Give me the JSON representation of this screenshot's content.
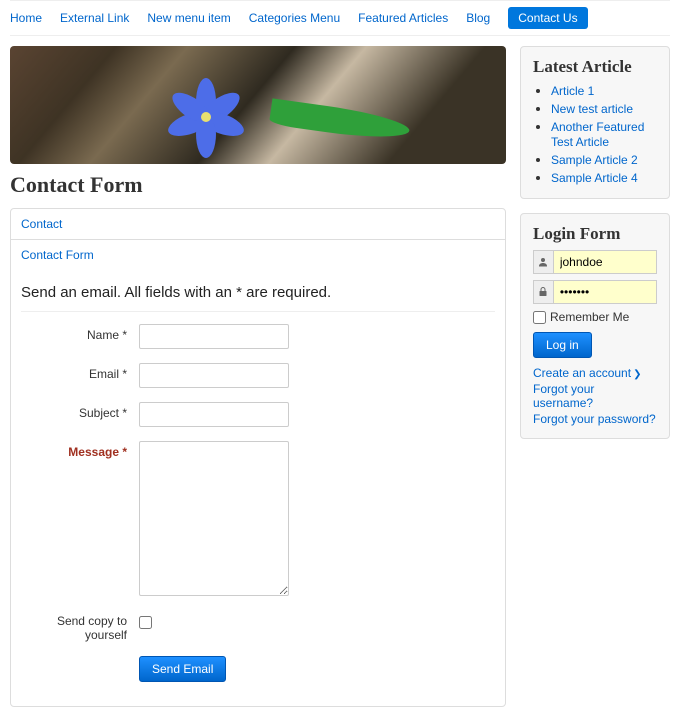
{
  "nav": {
    "items": [
      {
        "label": "Home"
      },
      {
        "label": "External Link"
      },
      {
        "label": "New menu item"
      },
      {
        "label": "Categories Menu"
      },
      {
        "label": "Featured Articles"
      },
      {
        "label": "Blog"
      },
      {
        "label": "Contact Us",
        "active": true
      }
    ]
  },
  "page_title": "Contact Form",
  "tabs": {
    "tab1": "Contact",
    "tab2": "Contact Form"
  },
  "form": {
    "description": "Send an email. All fields with an * are required.",
    "name_label": "Name *",
    "name_value": "",
    "email_label": "Email *",
    "email_value": "",
    "subject_label": "Subject *",
    "subject_value": "",
    "message_label": "Message *",
    "message_value": "",
    "copy_label": "Send copy to yourself",
    "submit_label": "Send Email"
  },
  "latest": {
    "title": "Latest Article",
    "items": [
      "Article 1",
      "New test article",
      "Another Featured Test Article",
      "Sample Article 2",
      "Sample Article 4"
    ]
  },
  "login": {
    "title": "Login Form",
    "username_value": "johndoe",
    "password_value": "•••••••",
    "remember_label": "Remember Me",
    "submit_label": "Log in",
    "create_label": "Create an account",
    "forgot_user_label": "Forgot your username?",
    "forgot_pass_label": "Forgot your password?"
  }
}
